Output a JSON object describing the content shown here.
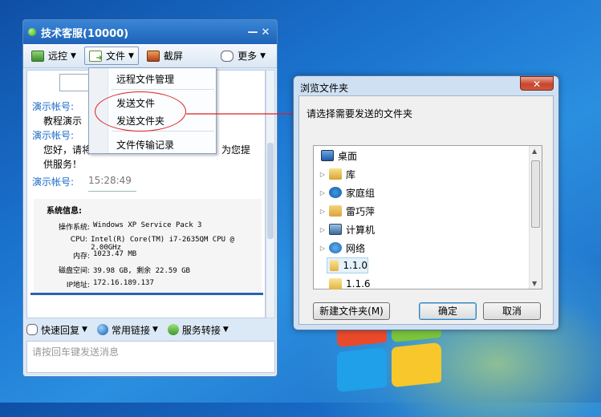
{
  "chat_window": {
    "title": "技术客服(10000)",
    "min_label": "—",
    "close_label": "✕",
    "toolbar": {
      "remote_label": "远控",
      "file_label": "文件",
      "screenshot_label": "截屏",
      "more_label": "更多"
    },
    "file_menu": {
      "items": [
        "远程文件管理",
        "发送文件",
        "发送文件夹",
        "文件传输记录"
      ]
    },
    "messages": [
      {
        "sender": "演示帐号:",
        "text": "教程演示"
      },
      {
        "sender": "演示帐号:",
        "text": "您好，请将",
        "text2": "为您提",
        "text3": "供服务！"
      },
      {
        "sender": "演示帐号:",
        "time": "15:28:49"
      }
    ],
    "system_info": {
      "heading": "系统信息:",
      "rows": [
        {
          "label": "操作系统:",
          "value": "Windows XP Service Pack 3"
        },
        {
          "label": "CPU:",
          "value": "Intel(R) Core(TM) i7-2635QM CPU @ 2.00GHz"
        },
        {
          "label": "内存:",
          "value": "1023.47 MB"
        },
        {
          "label": "磁盘空间:",
          "value": "39.98 GB, 剩余 22.59 GB"
        },
        {
          "label": "IP地址:",
          "value": "172.16.189.137"
        }
      ]
    },
    "bottom_bar": {
      "quick_reply": "快速回复",
      "common_links": "常用链接",
      "service_transfer": "服务转接"
    },
    "input_placeholder": "请按回车键发送消息"
  },
  "dialog": {
    "title": "浏览文件夹",
    "close_label": "✕",
    "prompt": "请选择需要发送的文件夹",
    "tree_items": [
      "桌面",
      "库",
      "家庭组",
      "雷巧萍",
      "计算机",
      "网络",
      "1.1.0",
      "1.1.6"
    ],
    "new_folder_button": "新建文件夹(M)",
    "ok_button": "确定",
    "cancel_button": "取消"
  },
  "colors": {
    "desktop": "#1b74cf",
    "title_bar": "#1e63b7",
    "sender": "#1a6ac8",
    "annotation": "#e02020"
  }
}
